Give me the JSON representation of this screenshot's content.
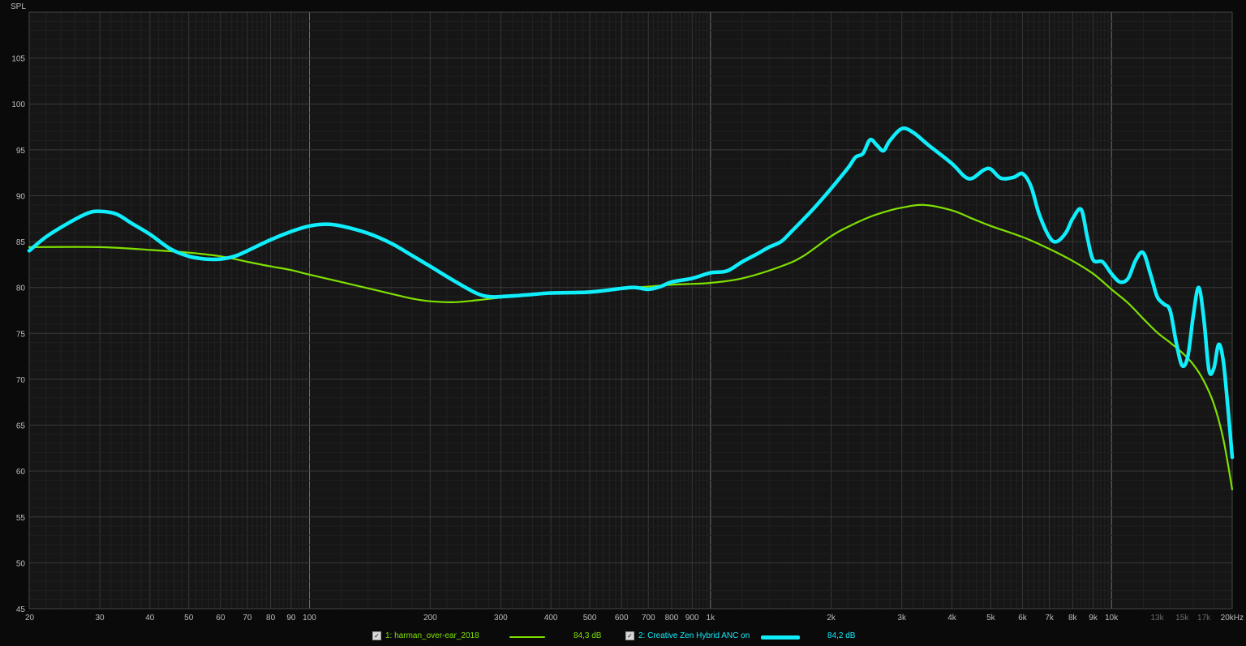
{
  "chart_data": {
    "type": "line",
    "ylabel": "SPL",
    "xscale": "log",
    "xlim": [
      20,
      20000
    ],
    "ylim": [
      45,
      110
    ],
    "grid": true,
    "y_ticks": [
      "45",
      "50",
      "55",
      "60",
      "65",
      "70",
      "75",
      "80",
      "85",
      "90",
      "95",
      "100",
      "105"
    ],
    "x_ticks": [
      {
        "v": 20,
        "t": "20"
      },
      {
        "v": 30,
        "t": "30"
      },
      {
        "v": 40,
        "t": "40"
      },
      {
        "v": 50,
        "t": "50"
      },
      {
        "v": 60,
        "t": "60"
      },
      {
        "v": 70,
        "t": "70"
      },
      {
        "v": 80,
        "t": "80"
      },
      {
        "v": 90,
        "t": "90"
      },
      {
        "v": 100,
        "t": "100"
      },
      {
        "v": 200,
        "t": "200"
      },
      {
        "v": 300,
        "t": "300"
      },
      {
        "v": 400,
        "t": "400"
      },
      {
        "v": 500,
        "t": "500"
      },
      {
        "v": 600,
        "t": "600"
      },
      {
        "v": 700,
        "t": "700"
      },
      {
        "v": 800,
        "t": "800"
      },
      {
        "v": 900,
        "t": "900"
      },
      {
        "v": 1000,
        "t": "1k"
      },
      {
        "v": 2000,
        "t": "2k"
      },
      {
        "v": 3000,
        "t": "3k"
      },
      {
        "v": 4000,
        "t": "4k"
      },
      {
        "v": 5000,
        "t": "5k"
      },
      {
        "v": 6000,
        "t": "6k"
      },
      {
        "v": 7000,
        "t": "7k"
      },
      {
        "v": 8000,
        "t": "8k"
      },
      {
        "v": 9000,
        "t": "9k"
      },
      {
        "v": 10000,
        "t": "10k"
      },
      {
        "v": 13000,
        "t": "13k",
        "dim": true
      },
      {
        "v": 15000,
        "t": "15k",
        "dim": true
      },
      {
        "v": 17000,
        "t": "17k",
        "dim": true
      },
      {
        "v": 20000,
        "t": "20kHz"
      }
    ],
    "series": [
      {
        "name": "1: harman_over-ear_2018",
        "color": "#7fe000",
        "level": "84,3 dB",
        "points": [
          [
            20,
            84.4
          ],
          [
            30,
            84.4
          ],
          [
            40,
            84.1
          ],
          [
            50,
            83.8
          ],
          [
            60,
            83.4
          ],
          [
            70,
            82.8
          ],
          [
            80,
            82.3
          ],
          [
            90,
            81.9
          ],
          [
            100,
            81.4
          ],
          [
            120,
            80.6
          ],
          [
            150,
            79.6
          ],
          [
            180,
            78.8
          ],
          [
            200,
            78.5
          ],
          [
            230,
            78.4
          ],
          [
            260,
            78.6
          ],
          [
            300,
            78.9
          ],
          [
            400,
            79.4
          ],
          [
            500,
            79.6
          ],
          [
            600,
            79.9
          ],
          [
            700,
            80.1
          ],
          [
            800,
            80.3
          ],
          [
            900,
            80.4
          ],
          [
            1000,
            80.5
          ],
          [
            1200,
            81.0
          ],
          [
            1500,
            82.3
          ],
          [
            1700,
            83.4
          ],
          [
            2000,
            85.6
          ],
          [
            2200,
            86.6
          ],
          [
            2500,
            87.7
          ],
          [
            2800,
            88.4
          ],
          [
            3000,
            88.7
          ],
          [
            3400,
            89.0
          ],
          [
            4000,
            88.4
          ],
          [
            4500,
            87.5
          ],
          [
            5000,
            86.7
          ],
          [
            6000,
            85.5
          ],
          [
            7000,
            84.2
          ],
          [
            8000,
            82.9
          ],
          [
            9000,
            81.5
          ],
          [
            10000,
            79.8
          ],
          [
            11000,
            78.3
          ],
          [
            12000,
            76.6
          ],
          [
            13000,
            75.1
          ],
          [
            14000,
            74.0
          ],
          [
            15000,
            72.9
          ],
          [
            16000,
            71.6
          ],
          [
            17000,
            69.8
          ],
          [
            18000,
            67.3
          ],
          [
            19000,
            63.5
          ],
          [
            20000,
            58.0
          ]
        ]
      },
      {
        "name": "2: Creative Zen Hybrid ANC on",
        "color": "#10eefc",
        "level": "84,2 dB",
        "points": [
          [
            20,
            84.0
          ],
          [
            22,
            85.5
          ],
          [
            25,
            87.0
          ],
          [
            28,
            88.1
          ],
          [
            30,
            88.3
          ],
          [
            33,
            88.0
          ],
          [
            36,
            87.0
          ],
          [
            40,
            85.8
          ],
          [
            45,
            84.2
          ],
          [
            50,
            83.4
          ],
          [
            55,
            83.1
          ],
          [
            60,
            83.1
          ],
          [
            65,
            83.4
          ],
          [
            70,
            84.0
          ],
          [
            80,
            85.2
          ],
          [
            90,
            86.1
          ],
          [
            100,
            86.7
          ],
          [
            110,
            86.9
          ],
          [
            120,
            86.7
          ],
          [
            140,
            85.9
          ],
          [
            160,
            84.8
          ],
          [
            180,
            83.5
          ],
          [
            200,
            82.3
          ],
          [
            230,
            80.7
          ],
          [
            260,
            79.4
          ],
          [
            280,
            79.0
          ],
          [
            300,
            79.0
          ],
          [
            350,
            79.2
          ],
          [
            400,
            79.4
          ],
          [
            500,
            79.5
          ],
          [
            600,
            79.9
          ],
          [
            650,
            80.0
          ],
          [
            700,
            79.8
          ],
          [
            750,
            80.1
          ],
          [
            800,
            80.6
          ],
          [
            900,
            81.0
          ],
          [
            1000,
            81.6
          ],
          [
            1100,
            81.8
          ],
          [
            1200,
            82.8
          ],
          [
            1300,
            83.6
          ],
          [
            1400,
            84.4
          ],
          [
            1500,
            85.0
          ],
          [
            1600,
            86.2
          ],
          [
            1800,
            88.5
          ],
          [
            2000,
            90.8
          ],
          [
            2200,
            93.0
          ],
          [
            2300,
            94.2
          ],
          [
            2400,
            94.6
          ],
          [
            2500,
            96.1
          ],
          [
            2600,
            95.5
          ],
          [
            2700,
            94.9
          ],
          [
            2800,
            96.0
          ],
          [
            3000,
            97.3
          ],
          [
            3200,
            96.9
          ],
          [
            3500,
            95.5
          ],
          [
            4000,
            93.5
          ],
          [
            4300,
            92.1
          ],
          [
            4500,
            91.9
          ],
          [
            4800,
            92.8
          ],
          [
            5000,
            92.9
          ],
          [
            5300,
            91.9
          ],
          [
            5700,
            92.0
          ],
          [
            6000,
            92.4
          ],
          [
            6300,
            91.0
          ],
          [
            6600,
            88.0
          ],
          [
            7000,
            85.5
          ],
          [
            7300,
            85.0
          ],
          [
            7700,
            86.0
          ],
          [
            8000,
            87.5
          ],
          [
            8400,
            88.5
          ],
          [
            8700,
            85.5
          ],
          [
            9000,
            83.0
          ],
          [
            9500,
            82.8
          ],
          [
            10000,
            81.5
          ],
          [
            10500,
            80.6
          ],
          [
            11000,
            81.0
          ],
          [
            11500,
            83.0
          ],
          [
            12000,
            83.8
          ],
          [
            12500,
            81.5
          ],
          [
            13000,
            79.0
          ],
          [
            13500,
            78.2
          ],
          [
            14000,
            77.5
          ],
          [
            14500,
            74.0
          ],
          [
            15000,
            71.5
          ],
          [
            15500,
            72.5
          ],
          [
            16000,
            77.0
          ],
          [
            16500,
            80.0
          ],
          [
            17000,
            76.5
          ],
          [
            17500,
            71.0
          ],
          [
            18000,
            71.2
          ],
          [
            18500,
            73.8
          ],
          [
            19000,
            72.0
          ],
          [
            19500,
            67.0
          ],
          [
            20000,
            61.5
          ]
        ]
      }
    ]
  }
}
